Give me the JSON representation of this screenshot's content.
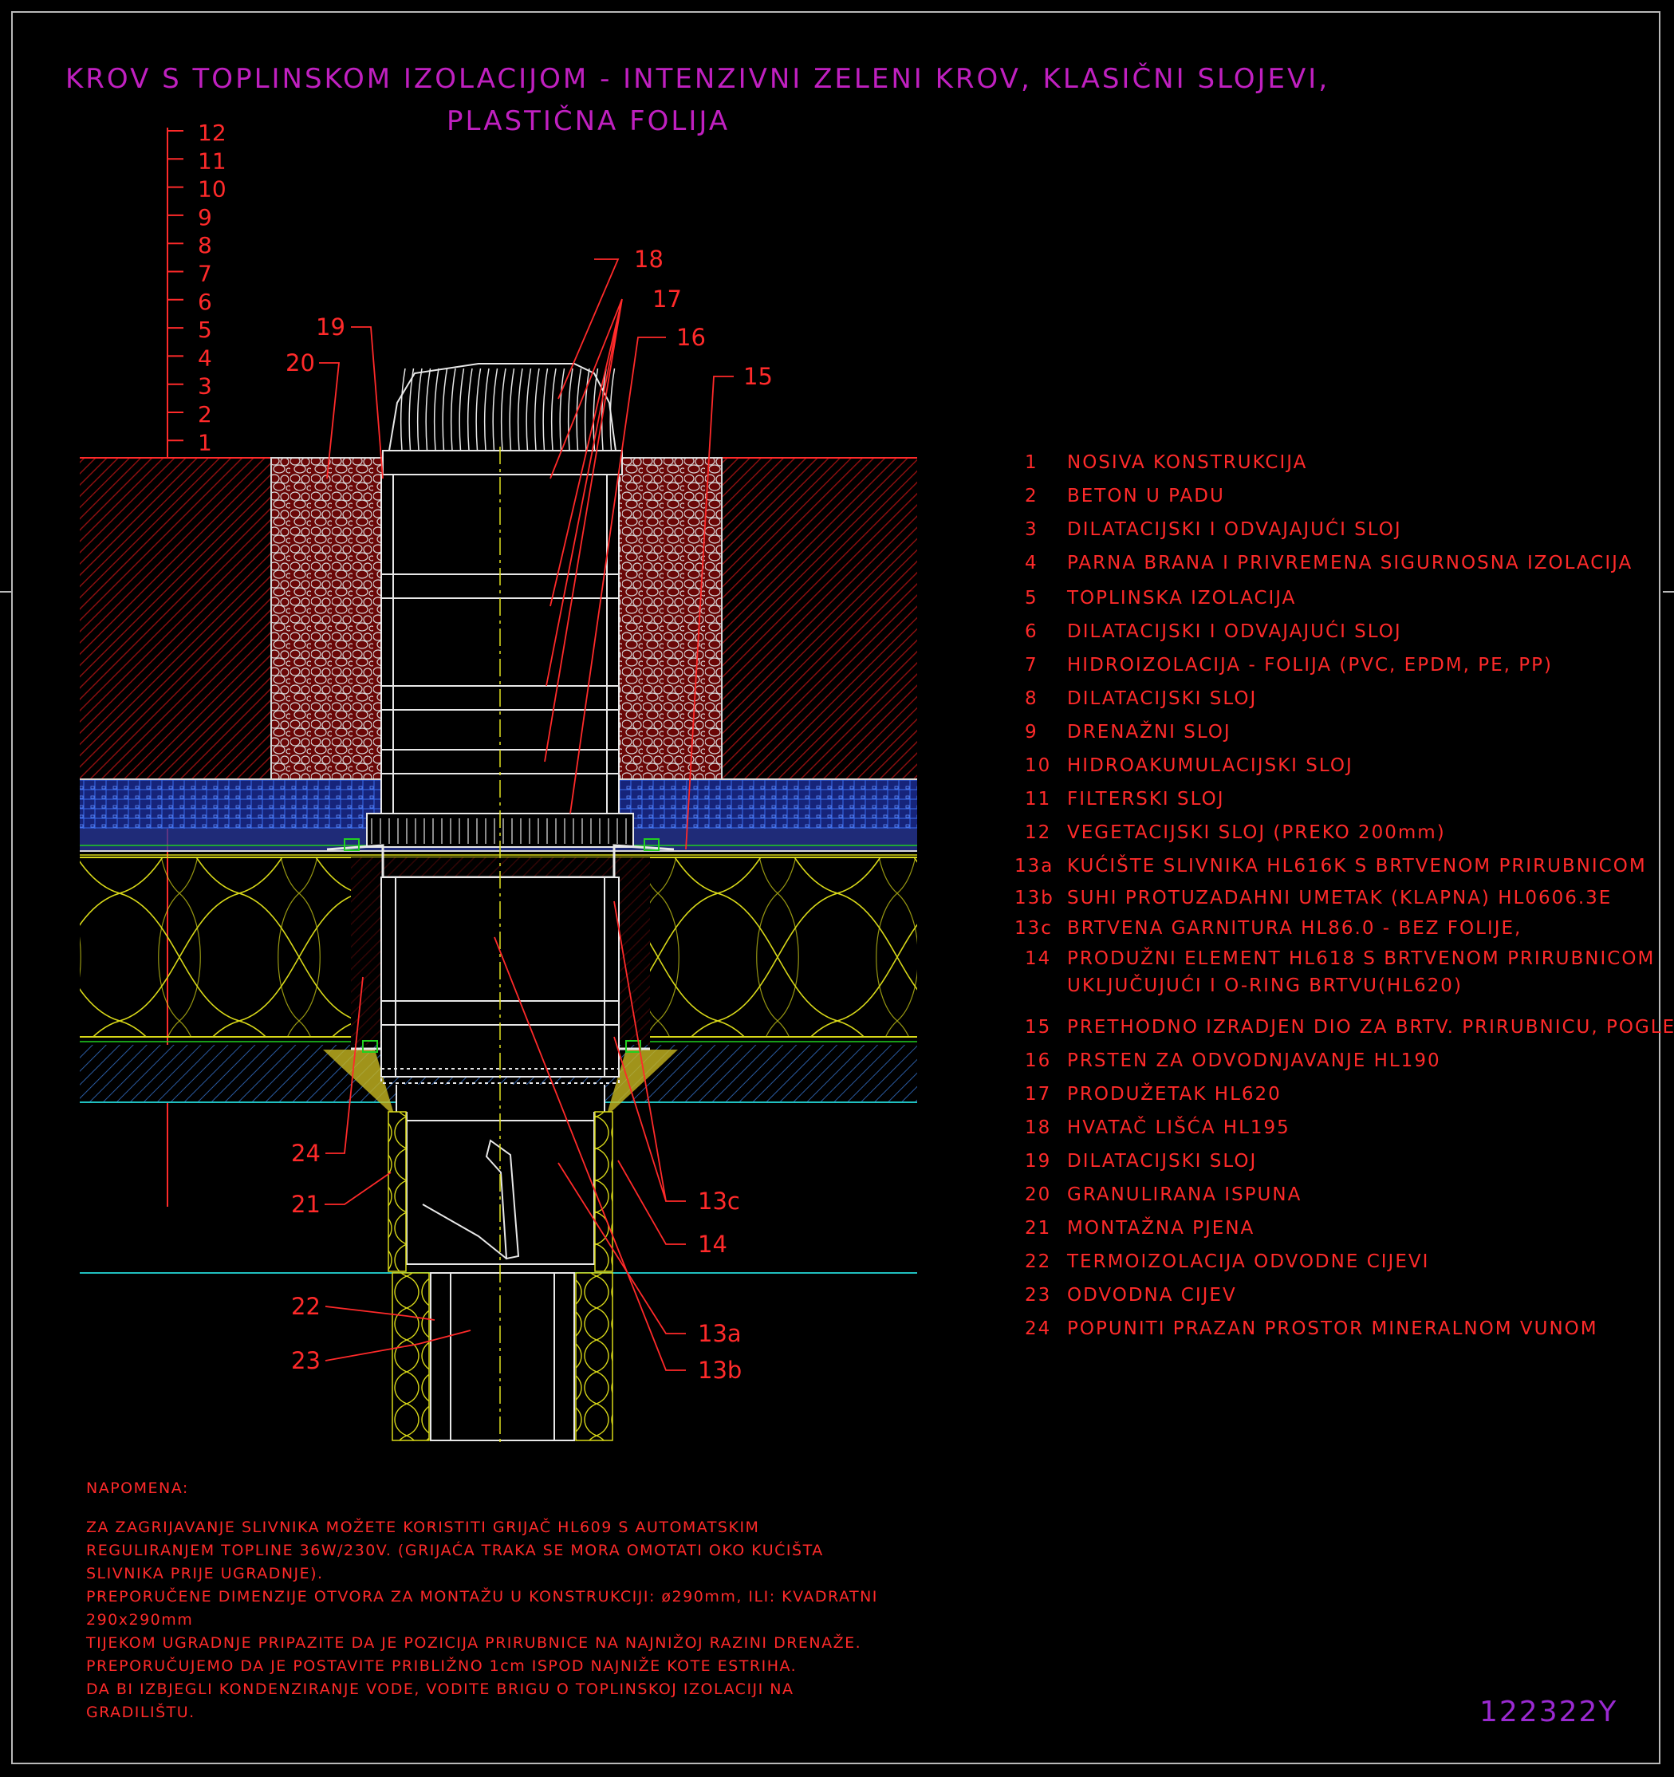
{
  "title": {
    "line1": "KROV S TOPLINSKOM IZOLACIJOM - INTENZIVNI ZELENI KROV, KLASIČNI SLOJEVI,",
    "line2": "PLASTIČNA FOLIJA"
  },
  "drawing_code": "122322Y",
  "scale_marks": [
    "12",
    "11",
    "10",
    "9",
    "8",
    "7",
    "6",
    "5",
    "4",
    "3",
    "2",
    "1"
  ],
  "callouts": [
    {
      "id": "c18",
      "label": "18"
    },
    {
      "id": "c17",
      "label": "17"
    },
    {
      "id": "c16",
      "label": "16"
    },
    {
      "id": "c15",
      "label": "15"
    },
    {
      "id": "c19",
      "label": "19"
    },
    {
      "id": "c20",
      "label": "20"
    },
    {
      "id": "c24",
      "label": "24"
    },
    {
      "id": "c21",
      "label": "21"
    },
    {
      "id": "c22",
      "label": "22"
    },
    {
      "id": "c23",
      "label": "23"
    },
    {
      "id": "c13c",
      "label": "13c"
    },
    {
      "id": "c14",
      "label": "14"
    },
    {
      "id": "c13a",
      "label": "13a"
    },
    {
      "id": "c13b",
      "label": "13b"
    }
  ],
  "legend": [
    {
      "num": "1",
      "text": "NOSIVA KONSTRUKCIJA"
    },
    {
      "num": "2",
      "text": "BETON U PADU"
    },
    {
      "num": "3",
      "text": "DILATACIJSKI I ODVAJAJUĆI SLOJ"
    },
    {
      "num": "4",
      "text": "PARNA BRANA I PRIVREMENA SIGURNOSNA IZOLACIJA"
    },
    {
      "num": "5",
      "text": "TOPLINSKA IZOLACIJA"
    },
    {
      "num": "6",
      "text": "DILATACIJSKI I ODVAJAJUĆI SLOJ"
    },
    {
      "num": "7",
      "text": "HIDROIZOLACIJA - FOLIJA (PVC, EPDM, PE, PP)"
    },
    {
      "num": "8",
      "text": "DILATACIJSKI SLOJ"
    },
    {
      "num": "9",
      "text": "DRENAŽNI SLOJ"
    },
    {
      "num": "10",
      "text": "HIDROAKUMULACIJSKI SLOJ"
    },
    {
      "num": "11",
      "text": "FILTERSKI SLOJ"
    },
    {
      "num": "12",
      "text": "VEGETACIJSKI SLOJ (PREKO 200mm)"
    },
    {
      "num": "13a",
      "text": "KUĆIŠTE SLIVNIKA HL616K S BRTVENOM PRIRUBNICOM"
    },
    {
      "num": "13b",
      "text": "SUHI PROTUZADAHNI UMETAK (KLAPNA) HL0606.3E"
    },
    {
      "num": "13c",
      "text": "BRTVENA GARNITURA HL86.0 - BEZ FOLIJE,"
    },
    {
      "num": "14",
      "text": "PRODUŽNI ELEMENT HL618 S BRTVENOM PRIRUBNICOM",
      "text2": "UKLJUČUJUĆI I O-RING BRTVU(HL620)"
    },
    {
      "num": "15",
      "text": "PRETHODNO IZRADJEN DIO ZA BRTV. PRIRUBNICU, POGLEDATI DIO \"DODACI\""
    },
    {
      "num": "16",
      "text": "PRSTEN ZA ODVODNJAVANJE HL190"
    },
    {
      "num": "17",
      "text": "PRODUŽETAK HL620"
    },
    {
      "num": "18",
      "text": "HVATAČ LIŠĆA HL195"
    },
    {
      "num": "19",
      "text": "DILATACIJSKI SLOJ"
    },
    {
      "num": "20",
      "text": "GRANULIRANA ISPUNA"
    },
    {
      "num": "21",
      "text": "MONTAŽNA PJENA"
    },
    {
      "num": "22",
      "text": "TERMOIZOLACIJA ODVODNE CIJEVI"
    },
    {
      "num": "23",
      "text": "ODVODNA CIJEV"
    },
    {
      "num": "24",
      "text": "POPUNITI PRAZAN PROSTOR MINERALNOM VUNOM"
    }
  ],
  "notes": {
    "heading": "NAPOMENA:",
    "lines": [
      "ZA ZAGRIJAVANJE SLIVNIKA MOŽETE KORISTITI GRIJAČ HL609 S AUTOMATSKIM",
      "REGULIRANJEM TOPLINE 36W/230V. (GRIJAĆA TRAKA SE MORA OMOTATI OKO KUĆIŠTA",
      "SLIVNIKA PRIJE UGRADNJE).",
      "PREPORUČENE DIMENZIJE OTVORA ZA MONTAŽU U KONSTRUKCIJI: ø290mm, ILI: KVADRATNI",
      "290x290mm",
      "TIJEKOM UGRADNJE PRIPAZITE DA JE POZICIJA PRIRUBNICE NA NAJNIŽOJ RAZINI DRENAŽE.",
      "PREPORUČUJEMO DA JE POSTAVITE PRIBLIŽNO 1cm ISPOD NAJNIŽE KOTE ESTRIHA.",
      "DA BI IZBJEGLI KONDENZIRANJE VODE, VODITE BRIGU O TOPLINSKOJ IZOLACIJI NA",
      "GRADILIŠTU."
    ]
  },
  "colors": {
    "background": "#000000",
    "title": "#c020c0",
    "annotation": "#ff2a2a",
    "soil": "#8a0f0f",
    "drainage": "#1a2f9a",
    "insulation": "#e0e020",
    "concrete": "#2a5aa0",
    "drain_body": "#e8e8e8",
    "centerline": "#e0e020",
    "code": "#9a2ad0"
  }
}
